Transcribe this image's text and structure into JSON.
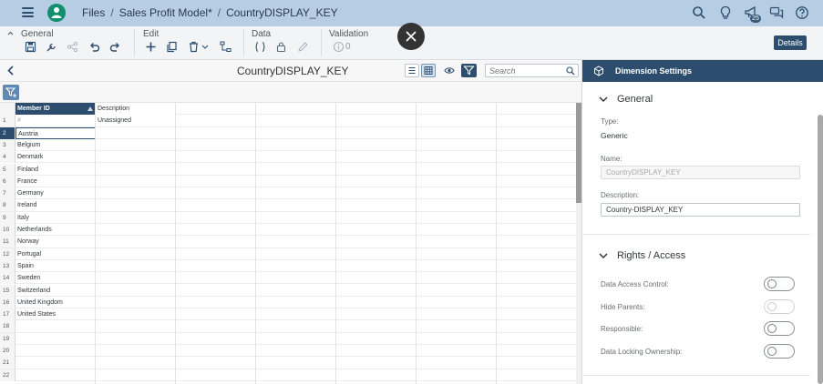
{
  "shell": {
    "breadcrumb": [
      "Files",
      "Sales Profit Model*",
      "CountryDISPLAY_KEY"
    ],
    "notification_count": "25"
  },
  "toolbar": {
    "groups": [
      "General",
      "Edit",
      "Data",
      "Validation"
    ],
    "validation_count": "0",
    "details_label": "Details"
  },
  "title_bar": {
    "title": "CountryDISPLAY_KEY",
    "search_placeholder": "Search"
  },
  "grid": {
    "columns": [
      "Member ID",
      "Description"
    ],
    "rows": [
      {
        "num": "1",
        "id": "#",
        "desc": "Unassigned"
      },
      {
        "num": "2",
        "id": "Austria",
        "desc": ""
      },
      {
        "num": "3",
        "id": "Belgium",
        "desc": ""
      },
      {
        "num": "4",
        "id": "Denmark",
        "desc": ""
      },
      {
        "num": "5",
        "id": "Finland",
        "desc": ""
      },
      {
        "num": "6",
        "id": "France",
        "desc": ""
      },
      {
        "num": "7",
        "id": "Germany",
        "desc": ""
      },
      {
        "num": "8",
        "id": "Ireland",
        "desc": ""
      },
      {
        "num": "9",
        "id": "Italy",
        "desc": ""
      },
      {
        "num": "10",
        "id": "Netherlands",
        "desc": ""
      },
      {
        "num": "11",
        "id": "Norway",
        "desc": ""
      },
      {
        "num": "12",
        "id": "Portugal",
        "desc": ""
      },
      {
        "num": "13",
        "id": "Spain",
        "desc": ""
      },
      {
        "num": "14",
        "id": "Sweden",
        "desc": ""
      },
      {
        "num": "15",
        "id": "Switzerland",
        "desc": ""
      },
      {
        "num": "16",
        "id": "United Kingdom",
        "desc": ""
      },
      {
        "num": "17",
        "id": "United States",
        "desc": ""
      },
      {
        "num": "18",
        "id": "",
        "desc": ""
      },
      {
        "num": "19",
        "id": "",
        "desc": ""
      },
      {
        "num": "20",
        "id": "",
        "desc": ""
      },
      {
        "num": "21",
        "id": "",
        "desc": ""
      },
      {
        "num": "22",
        "id": "",
        "desc": ""
      }
    ]
  },
  "panel": {
    "title": "Dimension Settings",
    "general_title": "General",
    "type_label": "Type:",
    "type_value": "Generic",
    "name_label": "Name:",
    "name_value": "CountryDISPLAY_KEY",
    "description_label": "Description:",
    "description_value": "Country-DISPLAY_KEY",
    "rights_title": "Rights / Access",
    "toggles": [
      {
        "label": "Data Access Control:",
        "on": false,
        "disabled": false
      },
      {
        "label": "Hide Parents:",
        "on": false,
        "disabled": true
      },
      {
        "label": "Responsible:",
        "on": false,
        "disabled": false
      },
      {
        "label": "Data Locking Ownership:",
        "on": false,
        "disabled": false
      }
    ]
  },
  "colors": {
    "shell_bg": "#b7cde3",
    "accent": "#2c4d6e",
    "home": "#0f8f6e"
  }
}
